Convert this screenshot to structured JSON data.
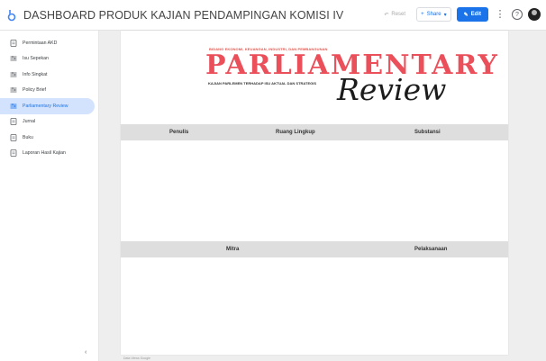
{
  "topbar": {
    "title": "DASHBOARD PRODUK KAJIAN PENDAMPINGAN KOMISI IV",
    "reset_label": "Reset",
    "share_label": "Share",
    "edit_label": "Edit"
  },
  "sidebar": {
    "items": [
      {
        "label": "Permintaan AKD",
        "icon": "document-icon"
      },
      {
        "label": "Isu Sepekan",
        "icon": "dashboard-icon"
      },
      {
        "label": "Info Singkat",
        "icon": "dashboard-icon"
      },
      {
        "label": "Policy Brief",
        "icon": "dashboard-icon"
      },
      {
        "label": "Parliamentary Review",
        "icon": "dashboard-icon",
        "active": true
      },
      {
        "label": "Jurnal",
        "icon": "document-icon"
      },
      {
        "label": "Buku",
        "icon": "document-icon"
      },
      {
        "label": "Laporan Hasil Kajian",
        "icon": "document-icon"
      }
    ],
    "collapse_glyph": "‹"
  },
  "report": {
    "banner": {
      "subtitle": "BIDANG EKONOMI, KEUANGAN, INDUSTRI, DAN PEMBANGUNAN",
      "main": "PARLIAMENTARY",
      "tagline": "KAJIAN PARLEMEN TERHADAP ISU AKTUAL DAN STRATEGIS",
      "review": "Review"
    },
    "table1": {
      "headers": [
        "Penulis",
        "Ruang Lingkup",
        "Substansi"
      ]
    },
    "table2": {
      "headers": [
        "Mitra",
        "Pelaksanaan"
      ]
    },
    "footer": "Data Views Google"
  },
  "colors": {
    "accent": "#1a73e8",
    "active_bg": "#d3e3fd",
    "brand_red": "#ea4f5a"
  }
}
